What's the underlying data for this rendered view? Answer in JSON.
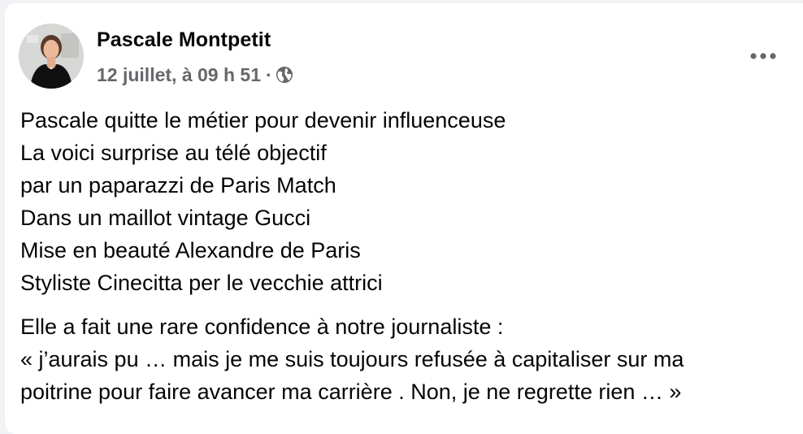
{
  "post": {
    "author": "Pascale Montpetit",
    "date": "12 juillet, à 09 h 51",
    "separator": "·",
    "privacy_icon": "globe-icon",
    "more_icon": "more-options-icon",
    "paragraphs": [
      [
        "Pascale quitte le métier pour devenir influenceuse",
        "La voici surprise au télé objectif",
        "par un paparazzi de Paris Match",
        "Dans un maillot vintage Gucci",
        "Mise en beauté Alexandre de Paris",
        "Styliste Cinecitta per le vecchie attrici"
      ],
      [
        "Elle a fait une rare confidence  à notre journaliste :",
        "« j’aurais pu … mais je me suis toujours refusée  à capitaliser sur ma",
        "poitrine pour faire avancer ma carrière . Non, je ne regrette rien … »"
      ]
    ]
  }
}
